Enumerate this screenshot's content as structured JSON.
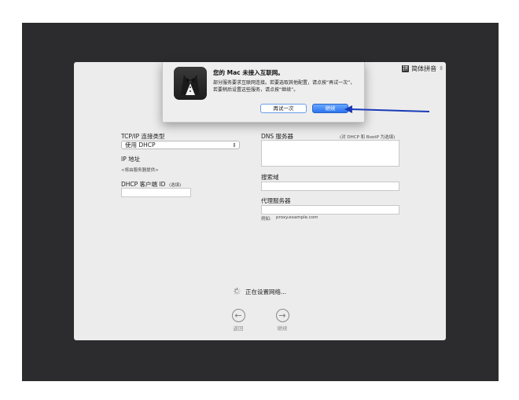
{
  "input_menu": {
    "icon": "input-source-icon",
    "label": "简体拼音",
    "chevron": "⌃⌄"
  },
  "dialog": {
    "title": "您的 Mac 未接入互联网。",
    "message": "部分服务要求互联网连接。若要选取其他配置，请点按“再试一次”，若要稍后设置这些服务，请点按“继续”。",
    "retry_label": "再试一次",
    "continue_label": "继续"
  },
  "network": {
    "tcpip_label": "TCP/IP 连接类型",
    "tcpip_value": "使用 DHCP",
    "ip_label": "IP 地址",
    "ip_value": "<将由服务器提供>",
    "dhcp_client_label": "DHCP 客户端 ID",
    "dhcp_client_hint": "(选填)",
    "dns_label": "DNS 服务器",
    "dns_hint": "(对 DHCP 和 BootP 为选填)",
    "search_domain_label": "搜索域",
    "proxy_label": "代理服务器",
    "proxy_example_prefix": "例如:",
    "proxy_example_value": "proxy.example.com"
  },
  "status": {
    "text": "正在设置网络..."
  },
  "nav": {
    "back_label": "返回",
    "continue_label": "继续"
  },
  "colors": {
    "accent": "#2b74ee",
    "arrow": "#1a3bb8",
    "panel": "#ececec",
    "backdrop": "#2c2c2e"
  }
}
